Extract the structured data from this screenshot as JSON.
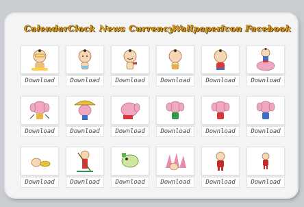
{
  "nav": {
    "items": [
      "Calendar",
      "Clock",
      "News",
      "Currency",
      "Wallpaper",
      "Icon",
      "Facebook"
    ]
  },
  "gallery": {
    "download_label": "Download",
    "rows": [
      [
        "boy-with-glasses",
        "boy-standing",
        "boy-smiling",
        "boy-holding-item",
        "boy-red-outfit",
        "boy-riding-elephant"
      ],
      [
        "elephant-dancing",
        "elephant-umbrella",
        "elephant-bowing",
        "elephant-green",
        "elephant-red",
        "elephant-blue"
      ],
      [
        "small-creature-lying",
        "boy-with-stick",
        "green-creature",
        "pink-pagoda-scene",
        "red-figure",
        "red-figure-small"
      ]
    ]
  },
  "colors": {
    "nav_text": "#d79a1c",
    "panel": "#f4f4f4",
    "background": "#c9ccd0"
  }
}
